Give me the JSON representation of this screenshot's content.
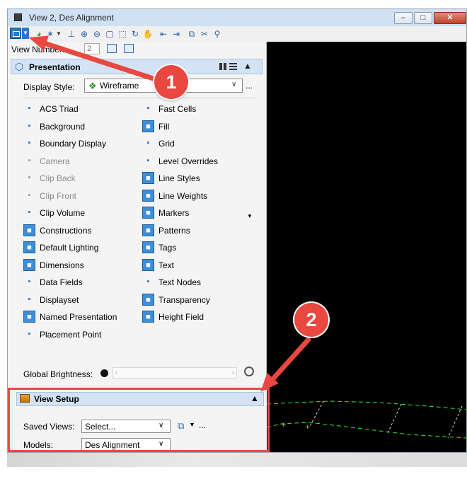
{
  "window": {
    "title": "View 2, Des Alignment",
    "controls": {
      "minimize": "–",
      "maximize": "□",
      "close": "✕"
    }
  },
  "flyout": {
    "view_number_label": "View Number:",
    "view_number_value": "2",
    "presentation": {
      "title": "Presentation",
      "display_style_label": "Display Style:",
      "display_style_value": "Wireframe",
      "more": "...",
      "left_items": [
        {
          "label": "ACS Triad",
          "icon": "acs-triad-icon",
          "state": "enabled"
        },
        {
          "label": "Background",
          "icon": "background-icon",
          "state": "enabled"
        },
        {
          "label": "Boundary Display",
          "icon": "boundary-display-icon",
          "state": "enabled"
        },
        {
          "label": "Camera",
          "icon": "camera-icon",
          "state": "disabled"
        },
        {
          "label": "Clip Back",
          "icon": "clip-back-icon",
          "state": "disabled"
        },
        {
          "label": "Clip Front",
          "icon": "clip-front-icon",
          "state": "disabled"
        },
        {
          "label": "Clip Volume",
          "icon": "clip-volume-icon",
          "state": "enabled"
        },
        {
          "label": "Constructions",
          "icon": "constructions-icon",
          "state": "on"
        },
        {
          "label": "Default Lighting",
          "icon": "default-lighting-icon",
          "state": "on"
        },
        {
          "label": "Dimensions",
          "icon": "dimensions-icon",
          "state": "on"
        },
        {
          "label": "Data Fields",
          "icon": "data-fields-icon",
          "state": "enabled"
        },
        {
          "label": "Displayset",
          "icon": "displayset-icon",
          "state": "enabled"
        },
        {
          "label": "Named Presentation",
          "icon": "named-presentation-icon",
          "state": "on"
        },
        {
          "label": "Placement Point",
          "icon": "placement-point-icon",
          "state": "enabled"
        }
      ],
      "right_items": [
        {
          "label": "Fast Cells",
          "icon": "fast-cells-icon",
          "state": "enabled"
        },
        {
          "label": "Fill",
          "icon": "fill-icon",
          "state": "on"
        },
        {
          "label": "Grid",
          "icon": "grid-icon",
          "state": "enabled"
        },
        {
          "label": "Level Overrides",
          "icon": "level-overrides-icon",
          "state": "enabled"
        },
        {
          "label": "Line Styles",
          "icon": "line-styles-icon",
          "state": "on"
        },
        {
          "label": "Line Weights",
          "icon": "line-weights-icon",
          "state": "on"
        },
        {
          "label": "Markers",
          "icon": "markers-icon",
          "state": "on"
        },
        {
          "label": "Patterns",
          "icon": "patterns-icon",
          "state": "on"
        },
        {
          "label": "Tags",
          "icon": "tags-icon",
          "state": "on"
        },
        {
          "label": "Text",
          "icon": "text-icon",
          "state": "on"
        },
        {
          "label": "Text Nodes",
          "icon": "text-nodes-icon",
          "state": "enabled"
        },
        {
          "label": "Transparency",
          "icon": "transparency-icon",
          "state": "on"
        },
        {
          "label": "Height Field",
          "icon": "height-field-icon",
          "state": "on"
        }
      ],
      "global_brightness_label": "Global Brightness:"
    }
  },
  "view_setup": {
    "title": "View Setup",
    "saved_views_label": "Saved Views:",
    "saved_views_value": "Select...",
    "models_label": "Models:",
    "models_value": "Des Alignment",
    "more": "..."
  },
  "callouts": {
    "one": "1",
    "two": "2"
  },
  "colors": {
    "accent": "#e8483f",
    "header_blue": "#d3e3f5",
    "toggle_on": "#3d8fd8"
  }
}
